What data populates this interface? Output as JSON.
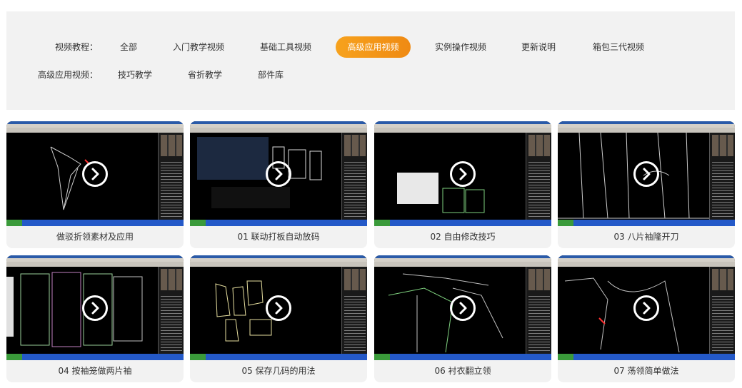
{
  "filters": {
    "row1": {
      "label": "视频教程：",
      "options": [
        "全部",
        "入门教学视频",
        "基础工具视频",
        "高级应用视频",
        "实例操作视频",
        "更新说明",
        "箱包三代视频"
      ],
      "active_index": 3
    },
    "row2": {
      "label": "高级应用视频：",
      "options": [
        "技巧教学",
        "省折教学",
        "部件库"
      ]
    }
  },
  "colors": {
    "active_pill": "#f29317",
    "panel_bg": "#f2f2f2",
    "card_bg": "#f2f2f2",
    "text": "#333333"
  },
  "videos": [
    {
      "title": "做驳折领素材及应用",
      "icon": "play-icon"
    },
    {
      "title": "01 联动打板自动放码",
      "icon": "play-icon"
    },
    {
      "title": "02 自由修改技巧",
      "icon": "play-icon"
    },
    {
      "title": "03 八片袖隆开刀",
      "icon": "play-icon"
    },
    {
      "title": "04 按袖笼做两片袖",
      "icon": "play-icon"
    },
    {
      "title": "05 保存几码的用法",
      "icon": "play-icon"
    },
    {
      "title": "06 衬衣翻立领",
      "icon": "play-icon"
    },
    {
      "title": "07 荡领简单做法",
      "icon": "play-icon"
    }
  ]
}
